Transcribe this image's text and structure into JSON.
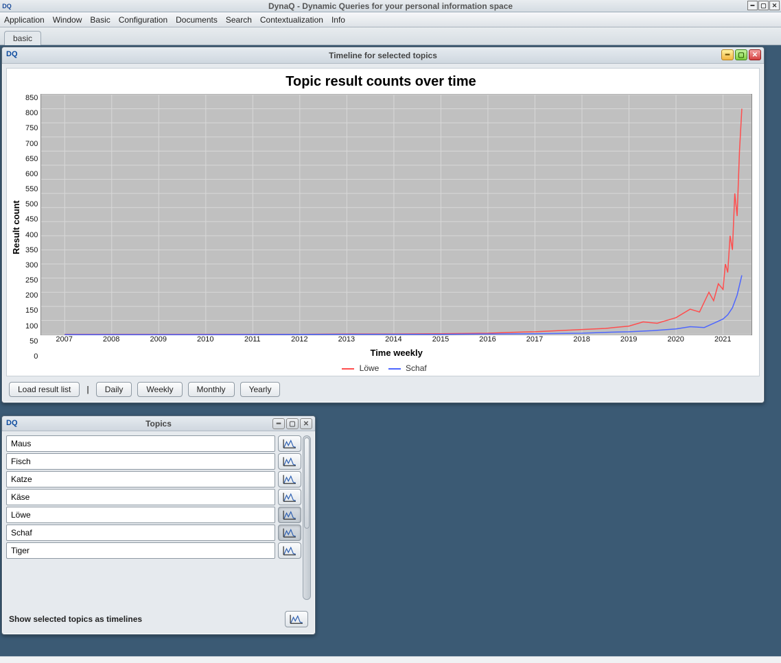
{
  "app_title": "DynaQ - Dynamic Queries for your personal information space",
  "app_icon": "DQ",
  "menubar": [
    "Application",
    "Window",
    "Basic",
    "Configuration",
    "Documents",
    "Search",
    "Contextualization",
    "Info"
  ],
  "tab": "basic",
  "timeline_window": {
    "title": "Timeline for selected topics",
    "buttons": {
      "load": "Load result list",
      "daily": "Daily",
      "weekly": "Weekly",
      "monthly": "Monthly",
      "yearly": "Yearly"
    }
  },
  "topics_window": {
    "title": "Topics",
    "items": [
      {
        "name": "Maus",
        "active": false
      },
      {
        "name": "Fisch",
        "active": false
      },
      {
        "name": "Katze",
        "active": false
      },
      {
        "name": "Käse",
        "active": false
      },
      {
        "name": "Löwe",
        "active": true
      },
      {
        "name": "Schaf",
        "active": true
      },
      {
        "name": "Tiger",
        "active": false
      }
    ],
    "footer": "Show selected topics as timelines"
  },
  "chart_data": {
    "type": "line",
    "title": "Topic result counts over time",
    "xlabel": "Time weekly",
    "ylabel": "Result count",
    "ylim": [
      0,
      850
    ],
    "yticks": [
      0,
      50,
      100,
      150,
      200,
      250,
      300,
      350,
      400,
      450,
      500,
      550,
      600,
      650,
      700,
      750,
      800,
      850
    ],
    "xticks": [
      2007,
      2008,
      2009,
      2010,
      2011,
      2012,
      2013,
      2014,
      2015,
      2016,
      2017,
      2018,
      2019,
      2020,
      2021
    ],
    "x_range": [
      "2006-06",
      "2021-07"
    ],
    "legend": [
      {
        "name": "Löwe",
        "color": "#ff4d4d"
      },
      {
        "name": "Schaf",
        "color": "#4d66ff"
      }
    ],
    "series": [
      {
        "name": "Löwe",
        "color": "#ff4d4d",
        "points": [
          {
            "x": "2007",
            "y": 1
          },
          {
            "x": "2008",
            "y": 1
          },
          {
            "x": "2009",
            "y": 1
          },
          {
            "x": "2010",
            "y": 1
          },
          {
            "x": "2011",
            "y": 1
          },
          {
            "x": "2012",
            "y": 1
          },
          {
            "x": "2013",
            "y": 2
          },
          {
            "x": "2014",
            "y": 2
          },
          {
            "x": "2015",
            "y": 3
          },
          {
            "x": "2016",
            "y": 5
          },
          {
            "x": "2016.5",
            "y": 8
          },
          {
            "x": "2017",
            "y": 10
          },
          {
            "x": "2017.5",
            "y": 14
          },
          {
            "x": "2018",
            "y": 18
          },
          {
            "x": "2018.5",
            "y": 22
          },
          {
            "x": "2019",
            "y": 30
          },
          {
            "x": "2019.3",
            "y": 45
          },
          {
            "x": "2019.6",
            "y": 40
          },
          {
            "x": "2020",
            "y": 60
          },
          {
            "x": "2020.3",
            "y": 90
          },
          {
            "x": "2020.5",
            "y": 80
          },
          {
            "x": "2020.7",
            "y": 150
          },
          {
            "x": "2020.8",
            "y": 120
          },
          {
            "x": "2020.9",
            "y": 180
          },
          {
            "x": "2021",
            "y": 160
          },
          {
            "x": "2021.05",
            "y": 250
          },
          {
            "x": "2021.1",
            "y": 220
          },
          {
            "x": "2021.15",
            "y": 350
          },
          {
            "x": "2021.2",
            "y": 300
          },
          {
            "x": "2021.25",
            "y": 500
          },
          {
            "x": "2021.3",
            "y": 420
          },
          {
            "x": "2021.35",
            "y": 650
          },
          {
            "x": "2021.4",
            "y": 800
          }
        ]
      },
      {
        "name": "Schaf",
        "color": "#4d66ff",
        "points": [
          {
            "x": "2007",
            "y": 0
          },
          {
            "x": "2010",
            "y": 0
          },
          {
            "x": "2013",
            "y": 1
          },
          {
            "x": "2015",
            "y": 1
          },
          {
            "x": "2016",
            "y": 2
          },
          {
            "x": "2017",
            "y": 3
          },
          {
            "x": "2018",
            "y": 5
          },
          {
            "x": "2018.5",
            "y": 8
          },
          {
            "x": "2019",
            "y": 10
          },
          {
            "x": "2019.5",
            "y": 14
          },
          {
            "x": "2020",
            "y": 20
          },
          {
            "x": "2020.3",
            "y": 28
          },
          {
            "x": "2020.6",
            "y": 25
          },
          {
            "x": "2020.8",
            "y": 40
          },
          {
            "x": "2021",
            "y": 55
          },
          {
            "x": "2021.1",
            "y": 70
          },
          {
            "x": "2021.2",
            "y": 95
          },
          {
            "x": "2021.3",
            "y": 140
          },
          {
            "x": "2021.4",
            "y": 210
          }
        ]
      }
    ]
  }
}
